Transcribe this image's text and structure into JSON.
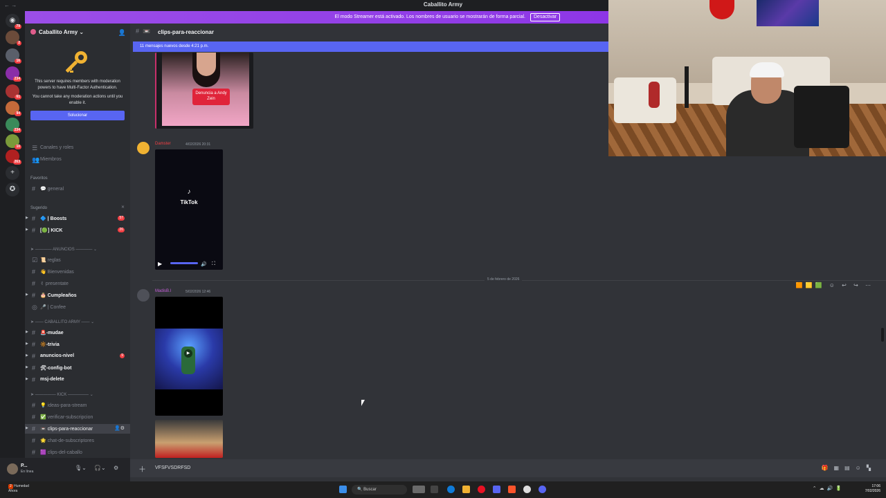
{
  "window": {
    "title": "Caballito Army"
  },
  "banner": {
    "text": "El modo Streamer está activado. Los nombres de usuario se mostrarán de forma parcial.",
    "button": "Desactivar"
  },
  "server_badges": [
    "79",
    "2",
    "16",
    "234",
    "61",
    "94",
    "234",
    "10",
    "263"
  ],
  "guild": {
    "name": "Caballito Army"
  },
  "mfa": {
    "line1": "This server requires members with moderation powers to have Multi-Factor Authentication.",
    "line2": "You cannot take any moderation actions until you enable it.",
    "button": "Solucionar"
  },
  "nav": {
    "channels_roles": "Canales y roles",
    "members": "Miembros"
  },
  "sections": {
    "favorites": "Favoritos",
    "suggested": "Sugerido"
  },
  "channels": [
    {
      "label": "💬 general",
      "y": 0
    },
    {
      "label": "🔷 | Boosts",
      "count": "57"
    },
    {
      "label": "[🟢] KICK",
      "count": "26"
    },
    {
      "label": "📜 reglas"
    },
    {
      "label": "👋 Bienvenidas"
    },
    {
      "label": "✌ presentate"
    },
    {
      "label": "🎂 Cumpleaños"
    },
    {
      "label": "🎤 | Confee"
    },
    {
      "label": "🚨-mudae"
    },
    {
      "label": "🔆-trivia"
    },
    {
      "label": "anuncios-nivel",
      "count": "9"
    },
    {
      "label": "🛠-config-bot"
    },
    {
      "label": "msj-delete"
    },
    {
      "label": "💡 ideas-para-stream"
    },
    {
      "label": "✅ verificar-subscripcion"
    },
    {
      "label": "📼 clips-para-reaccionar"
    },
    {
      "label": "🌟 chat-de-subscriptores"
    },
    {
      "label": "🟪 clips-del-caballo"
    }
  ],
  "categories": {
    "anuncios": "ANUNCIOS",
    "caballito": "CABALLITO ARMY",
    "kick": "KICK"
  },
  "user": {
    "name": "P...",
    "status": "En línea"
  },
  "chat": {
    "channel": "clips-para-reaccionar",
    "new_messages": "11 mensajes nuevos desde 4:21 p.m.",
    "clip_caption": "Denuncia a Andy Zein",
    "msg1_user": "Damster",
    "msg1_time": "4/02/2026 20:31",
    "tiktok": "TikTok",
    "date_sep": "5 de febrero de 2026",
    "msg2_user": "MadisB.l",
    "msg2_time": "5/02/2026 12:46",
    "composer_value": "VFSFVSDRFSD"
  },
  "taskbar": {
    "weather_temp": "2",
    "weather": "Humedad",
    "weather_sub": "Ahora",
    "search": "Buscar",
    "time": "17:06",
    "date": "7/02/2026"
  },
  "colors": {
    "accent": "#5865f2",
    "banner": "#8d36e6",
    "bg": "#313338",
    "sidebar": "#2b2d31"
  }
}
